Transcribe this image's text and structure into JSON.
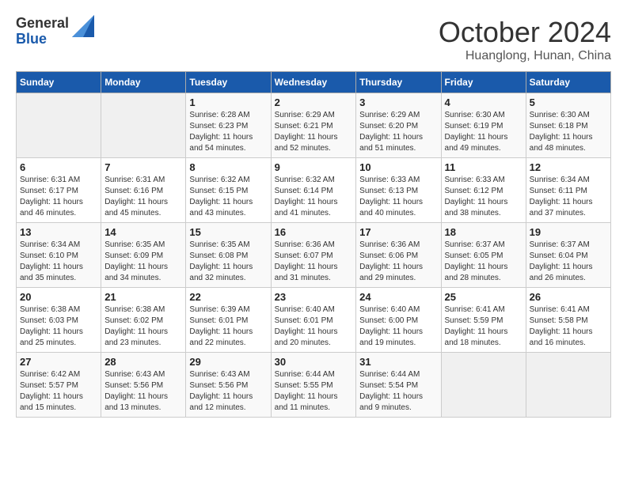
{
  "logo": {
    "general": "General",
    "blue": "Blue"
  },
  "header": {
    "month": "October 2024",
    "location": "Huanglong, Hunan, China"
  },
  "weekdays": [
    "Sunday",
    "Monday",
    "Tuesday",
    "Wednesday",
    "Thursday",
    "Friday",
    "Saturday"
  ],
  "weeks": [
    [
      {
        "day": "",
        "info": ""
      },
      {
        "day": "",
        "info": ""
      },
      {
        "day": "1",
        "info": "Sunrise: 6:28 AM\nSunset: 6:23 PM\nDaylight: 11 hours and 54 minutes."
      },
      {
        "day": "2",
        "info": "Sunrise: 6:29 AM\nSunset: 6:21 PM\nDaylight: 11 hours and 52 minutes."
      },
      {
        "day": "3",
        "info": "Sunrise: 6:29 AM\nSunset: 6:20 PM\nDaylight: 11 hours and 51 minutes."
      },
      {
        "day": "4",
        "info": "Sunrise: 6:30 AM\nSunset: 6:19 PM\nDaylight: 11 hours and 49 minutes."
      },
      {
        "day": "5",
        "info": "Sunrise: 6:30 AM\nSunset: 6:18 PM\nDaylight: 11 hours and 48 minutes."
      }
    ],
    [
      {
        "day": "6",
        "info": "Sunrise: 6:31 AM\nSunset: 6:17 PM\nDaylight: 11 hours and 46 minutes."
      },
      {
        "day": "7",
        "info": "Sunrise: 6:31 AM\nSunset: 6:16 PM\nDaylight: 11 hours and 45 minutes."
      },
      {
        "day": "8",
        "info": "Sunrise: 6:32 AM\nSunset: 6:15 PM\nDaylight: 11 hours and 43 minutes."
      },
      {
        "day": "9",
        "info": "Sunrise: 6:32 AM\nSunset: 6:14 PM\nDaylight: 11 hours and 41 minutes."
      },
      {
        "day": "10",
        "info": "Sunrise: 6:33 AM\nSunset: 6:13 PM\nDaylight: 11 hours and 40 minutes."
      },
      {
        "day": "11",
        "info": "Sunrise: 6:33 AM\nSunset: 6:12 PM\nDaylight: 11 hours and 38 minutes."
      },
      {
        "day": "12",
        "info": "Sunrise: 6:34 AM\nSunset: 6:11 PM\nDaylight: 11 hours and 37 minutes."
      }
    ],
    [
      {
        "day": "13",
        "info": "Sunrise: 6:34 AM\nSunset: 6:10 PM\nDaylight: 11 hours and 35 minutes."
      },
      {
        "day": "14",
        "info": "Sunrise: 6:35 AM\nSunset: 6:09 PM\nDaylight: 11 hours and 34 minutes."
      },
      {
        "day": "15",
        "info": "Sunrise: 6:35 AM\nSunset: 6:08 PM\nDaylight: 11 hours and 32 minutes."
      },
      {
        "day": "16",
        "info": "Sunrise: 6:36 AM\nSunset: 6:07 PM\nDaylight: 11 hours and 31 minutes."
      },
      {
        "day": "17",
        "info": "Sunrise: 6:36 AM\nSunset: 6:06 PM\nDaylight: 11 hours and 29 minutes."
      },
      {
        "day": "18",
        "info": "Sunrise: 6:37 AM\nSunset: 6:05 PM\nDaylight: 11 hours and 28 minutes."
      },
      {
        "day": "19",
        "info": "Sunrise: 6:37 AM\nSunset: 6:04 PM\nDaylight: 11 hours and 26 minutes."
      }
    ],
    [
      {
        "day": "20",
        "info": "Sunrise: 6:38 AM\nSunset: 6:03 PM\nDaylight: 11 hours and 25 minutes."
      },
      {
        "day": "21",
        "info": "Sunrise: 6:38 AM\nSunset: 6:02 PM\nDaylight: 11 hours and 23 minutes."
      },
      {
        "day": "22",
        "info": "Sunrise: 6:39 AM\nSunset: 6:01 PM\nDaylight: 11 hours and 22 minutes."
      },
      {
        "day": "23",
        "info": "Sunrise: 6:40 AM\nSunset: 6:01 PM\nDaylight: 11 hours and 20 minutes."
      },
      {
        "day": "24",
        "info": "Sunrise: 6:40 AM\nSunset: 6:00 PM\nDaylight: 11 hours and 19 minutes."
      },
      {
        "day": "25",
        "info": "Sunrise: 6:41 AM\nSunset: 5:59 PM\nDaylight: 11 hours and 18 minutes."
      },
      {
        "day": "26",
        "info": "Sunrise: 6:41 AM\nSunset: 5:58 PM\nDaylight: 11 hours and 16 minutes."
      }
    ],
    [
      {
        "day": "27",
        "info": "Sunrise: 6:42 AM\nSunset: 5:57 PM\nDaylight: 11 hours and 15 minutes."
      },
      {
        "day": "28",
        "info": "Sunrise: 6:43 AM\nSunset: 5:56 PM\nDaylight: 11 hours and 13 minutes."
      },
      {
        "day": "29",
        "info": "Sunrise: 6:43 AM\nSunset: 5:56 PM\nDaylight: 11 hours and 12 minutes."
      },
      {
        "day": "30",
        "info": "Sunrise: 6:44 AM\nSunset: 5:55 PM\nDaylight: 11 hours and 11 minutes."
      },
      {
        "day": "31",
        "info": "Sunrise: 6:44 AM\nSunset: 5:54 PM\nDaylight: 11 hours and 9 minutes."
      },
      {
        "day": "",
        "info": ""
      },
      {
        "day": "",
        "info": ""
      }
    ]
  ]
}
